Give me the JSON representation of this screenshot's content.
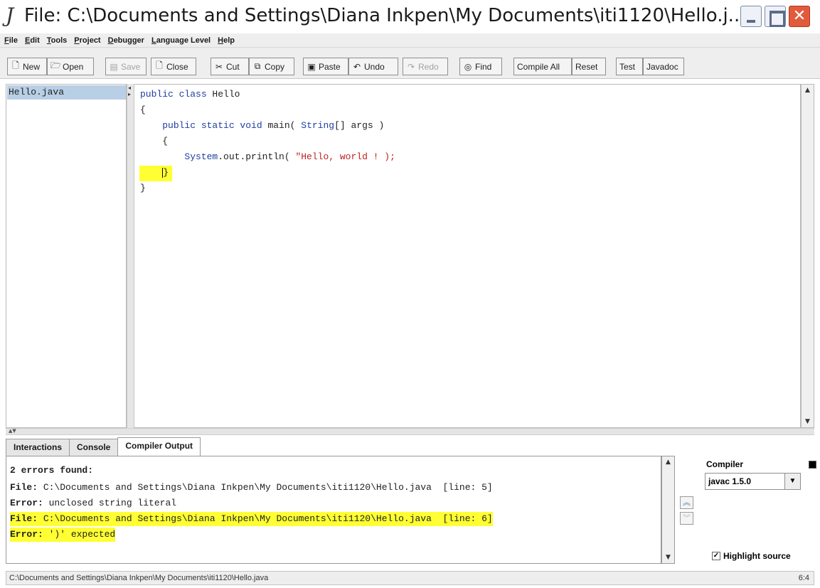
{
  "window": {
    "app_icon": "J",
    "title": "File: C:\\Documents and Settings\\Diana Inkpen\\My Documents\\iti1120\\Hello.j...",
    "close_glyph": "✕"
  },
  "menu": [
    {
      "mnemonic": "F",
      "rest": "ile"
    },
    {
      "mnemonic": "E",
      "rest": "dit"
    },
    {
      "mnemonic": "T",
      "rest": "ools"
    },
    {
      "mnemonic": "P",
      "rest": "roject"
    },
    {
      "mnemonic": "D",
      "rest": "ebugger"
    },
    {
      "mnemonic": "L",
      "rest": "anguage Level"
    },
    {
      "mnemonic": "H",
      "rest": "elp"
    }
  ],
  "toolbar": {
    "new": {
      "label": "New",
      "icon": "new-file-icon",
      "glyph": "🗋"
    },
    "open": {
      "label": "Open",
      "icon": "open-folder-icon",
      "glyph": "🗁"
    },
    "save": {
      "label": "Save",
      "icon": "save-icon",
      "glyph": "▤"
    },
    "close": {
      "label": "Close",
      "icon": "close-file-icon",
      "glyph": "🗋"
    },
    "cut": {
      "label": "Cut",
      "icon": "scissors-icon",
      "glyph": "✂"
    },
    "copy": {
      "label": "Copy",
      "icon": "copy-icon",
      "glyph": "⧉"
    },
    "paste": {
      "label": "Paste",
      "icon": "clipboard-icon",
      "glyph": "▣"
    },
    "undo": {
      "label": "Undo",
      "icon": "undo-icon",
      "glyph": "↶"
    },
    "redo": {
      "label": "Redo",
      "icon": "redo-icon",
      "glyph": "↷"
    },
    "find": {
      "label": "Find",
      "icon": "binoculars-icon",
      "glyph": "◎"
    },
    "compile_all": "Compile All",
    "reset": "Reset",
    "test": "Test",
    "javadoc": "Javadoc"
  },
  "files": [
    "Hello.java"
  ],
  "editor": {
    "lines": {
      "l1_kw": "public class",
      "l1_rest": " Hello",
      "l2": "{",
      "l3_indent": "    ",
      "l3_kw": "public static void",
      "l3_mid": " main( ",
      "l3_type": "String",
      "l3_end": "[] args )",
      "l4": "    {",
      "l5_indent": "        ",
      "l5_obj": "System",
      "l5_mid": ".out.println( ",
      "l5_str": "\"Hello, world ! );",
      "l6_indent": "    ",
      "l6_brace": "}",
      "l7": "}"
    }
  },
  "tabs": [
    "Interactions",
    "Console",
    "Compiler Output"
  ],
  "compiler_output": {
    "summary": "2 errors found:",
    "file_label": "File:",
    "error_label": "Error:",
    "errors": [
      {
        "file": " C:\\Documents and Settings\\Diana Inkpen\\My Documents\\iti1120\\Hello.java  [line: 5]",
        "message": " unclosed string literal"
      },
      {
        "file": " C:\\Documents and Settings\\Diana Inkpen\\My Documents\\iti1120\\Hello.java  [line: 6]",
        "message": " ')' expected"
      }
    ]
  },
  "compiler_panel": {
    "label": "Compiler",
    "selected": "javac 1.5.0",
    "highlight_source": "Highlight source",
    "highlight_checked": true
  },
  "status": {
    "path": "C:\\Documents and Settings\\Diana Inkpen\\My Documents\\iti1120\\Hello.java",
    "position": "6:4"
  },
  "colors": {
    "highlight": "#ffff33",
    "selection": "#b8cfe5",
    "keyword": "#1f3ea0",
    "string": "#c02020"
  }
}
